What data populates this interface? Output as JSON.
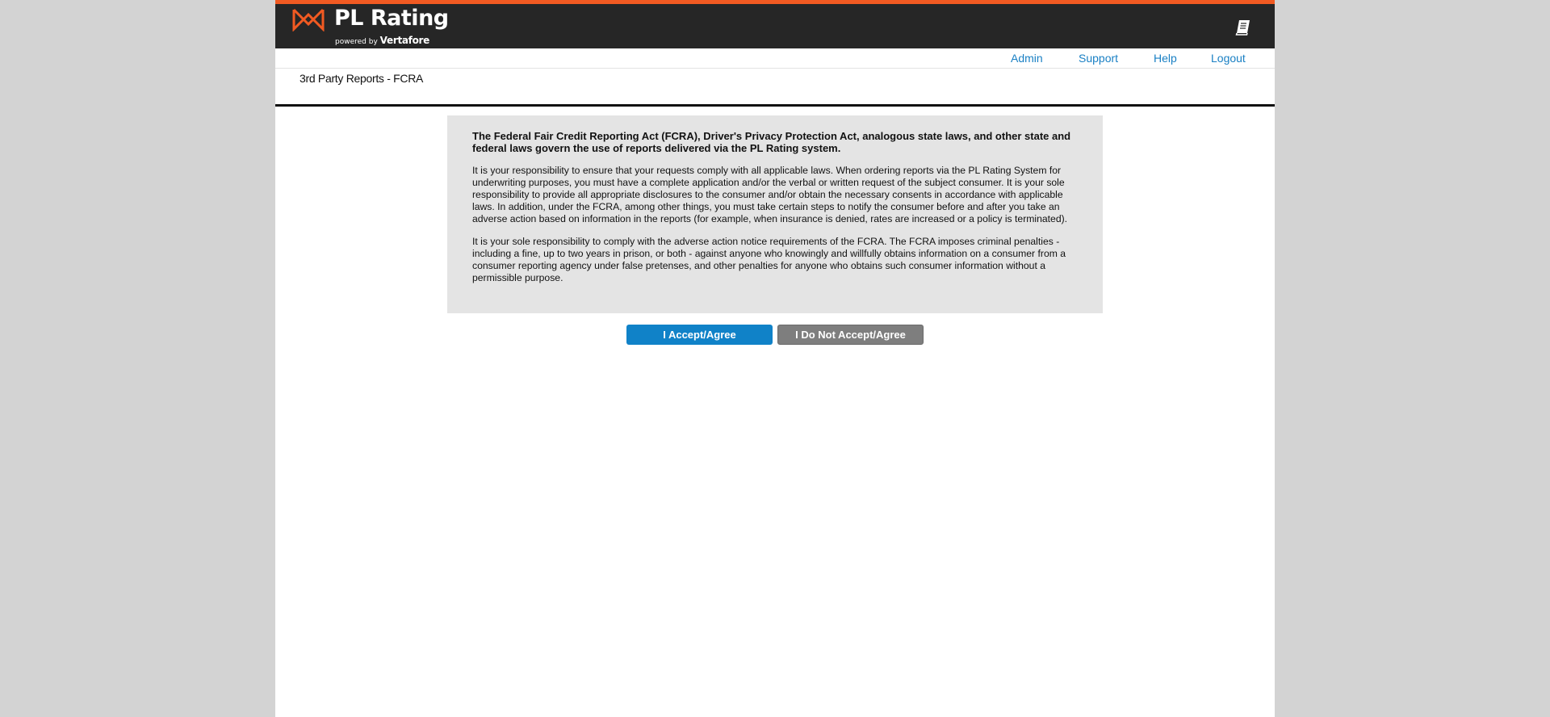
{
  "header": {
    "brand": "PL Rating",
    "powered_by": "powered by",
    "vendor": "Vertafore",
    "accent_color": "#f15a22",
    "help_icon": "book-icon"
  },
  "nav": {
    "items": [
      {
        "label": "Admin"
      },
      {
        "label": "Support"
      },
      {
        "label": "Help"
      },
      {
        "label": "Logout"
      }
    ]
  },
  "page": {
    "title": "3rd Party Reports - FCRA"
  },
  "notice": {
    "heading": "The Federal Fair Credit Reporting Act (FCRA), Driver's Privacy Protection Act, analogous state laws, and other state and federal laws govern the use of reports delivered via the PL Rating system.",
    "paragraph1": "It is your responsibility to ensure that your requests comply with all applicable laws. When ordering reports via the PL Rating System for underwriting purposes, you must have a complete application and/or the verbal or written request of the subject consumer. It is your sole responsibility to provide all appropriate disclosures to the consumer and/or obtain the necessary consents in accordance with applicable laws. In addition, under the FCRA, among other things, you must take certain steps to notify the consumer before and after you take an adverse action based on information in the reports (for example, when insurance is denied, rates are increased or a policy is terminated).",
    "paragraph2": "It is your sole responsibility to comply with the adverse action notice requirements of the FCRA. The FCRA imposes criminal penalties - including a fine, up to two years in prison, or both - against anyone who knowingly and willfully obtains information on a consumer from a consumer reporting agency under false pretenses, and other penalties for anyone who obtains such consumer information without a permissible purpose."
  },
  "actions": {
    "accept_label": "I Accept/Agree",
    "decline_label": "I Do Not Accept/Agree",
    "accept_color": "#1082c8",
    "decline_color": "#7e7e7e"
  }
}
